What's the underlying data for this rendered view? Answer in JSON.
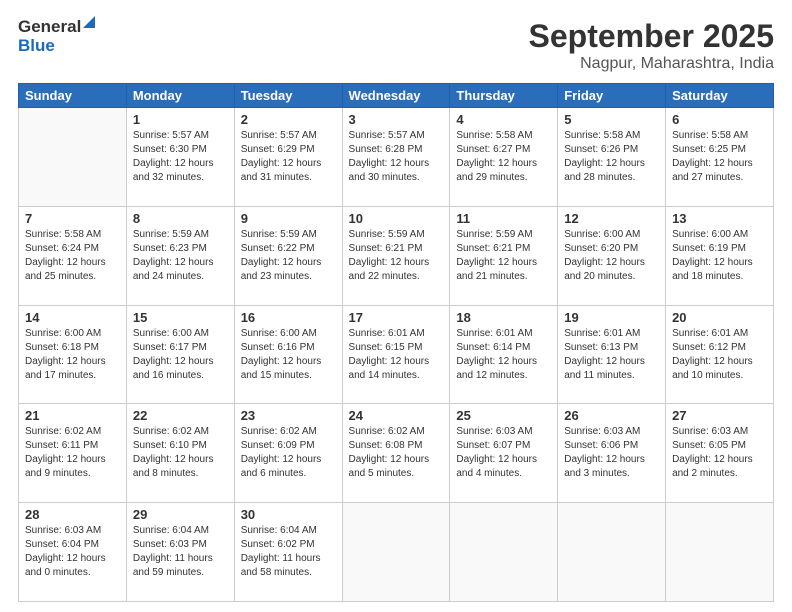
{
  "header": {
    "logo_line1": "General",
    "logo_line2": "Blue",
    "month": "September 2025",
    "location": "Nagpur, Maharashtra, India"
  },
  "weekdays": [
    "Sunday",
    "Monday",
    "Tuesday",
    "Wednesday",
    "Thursday",
    "Friday",
    "Saturday"
  ],
  "weeks": [
    [
      {
        "day": "",
        "info": ""
      },
      {
        "day": "1",
        "info": "Sunrise: 5:57 AM\nSunset: 6:30 PM\nDaylight: 12 hours\nand 32 minutes."
      },
      {
        "day": "2",
        "info": "Sunrise: 5:57 AM\nSunset: 6:29 PM\nDaylight: 12 hours\nand 31 minutes."
      },
      {
        "day": "3",
        "info": "Sunrise: 5:57 AM\nSunset: 6:28 PM\nDaylight: 12 hours\nand 30 minutes."
      },
      {
        "day": "4",
        "info": "Sunrise: 5:58 AM\nSunset: 6:27 PM\nDaylight: 12 hours\nand 29 minutes."
      },
      {
        "day": "5",
        "info": "Sunrise: 5:58 AM\nSunset: 6:26 PM\nDaylight: 12 hours\nand 28 minutes."
      },
      {
        "day": "6",
        "info": "Sunrise: 5:58 AM\nSunset: 6:25 PM\nDaylight: 12 hours\nand 27 minutes."
      }
    ],
    [
      {
        "day": "7",
        "info": "Sunrise: 5:58 AM\nSunset: 6:24 PM\nDaylight: 12 hours\nand 25 minutes."
      },
      {
        "day": "8",
        "info": "Sunrise: 5:59 AM\nSunset: 6:23 PM\nDaylight: 12 hours\nand 24 minutes."
      },
      {
        "day": "9",
        "info": "Sunrise: 5:59 AM\nSunset: 6:22 PM\nDaylight: 12 hours\nand 23 minutes."
      },
      {
        "day": "10",
        "info": "Sunrise: 5:59 AM\nSunset: 6:21 PM\nDaylight: 12 hours\nand 22 minutes."
      },
      {
        "day": "11",
        "info": "Sunrise: 5:59 AM\nSunset: 6:21 PM\nDaylight: 12 hours\nand 21 minutes."
      },
      {
        "day": "12",
        "info": "Sunrise: 6:00 AM\nSunset: 6:20 PM\nDaylight: 12 hours\nand 20 minutes."
      },
      {
        "day": "13",
        "info": "Sunrise: 6:00 AM\nSunset: 6:19 PM\nDaylight: 12 hours\nand 18 minutes."
      }
    ],
    [
      {
        "day": "14",
        "info": "Sunrise: 6:00 AM\nSunset: 6:18 PM\nDaylight: 12 hours\nand 17 minutes."
      },
      {
        "day": "15",
        "info": "Sunrise: 6:00 AM\nSunset: 6:17 PM\nDaylight: 12 hours\nand 16 minutes."
      },
      {
        "day": "16",
        "info": "Sunrise: 6:00 AM\nSunset: 6:16 PM\nDaylight: 12 hours\nand 15 minutes."
      },
      {
        "day": "17",
        "info": "Sunrise: 6:01 AM\nSunset: 6:15 PM\nDaylight: 12 hours\nand 14 minutes."
      },
      {
        "day": "18",
        "info": "Sunrise: 6:01 AM\nSunset: 6:14 PM\nDaylight: 12 hours\nand 12 minutes."
      },
      {
        "day": "19",
        "info": "Sunrise: 6:01 AM\nSunset: 6:13 PM\nDaylight: 12 hours\nand 11 minutes."
      },
      {
        "day": "20",
        "info": "Sunrise: 6:01 AM\nSunset: 6:12 PM\nDaylight: 12 hours\nand 10 minutes."
      }
    ],
    [
      {
        "day": "21",
        "info": "Sunrise: 6:02 AM\nSunset: 6:11 PM\nDaylight: 12 hours\nand 9 minutes."
      },
      {
        "day": "22",
        "info": "Sunrise: 6:02 AM\nSunset: 6:10 PM\nDaylight: 12 hours\nand 8 minutes."
      },
      {
        "day": "23",
        "info": "Sunrise: 6:02 AM\nSunset: 6:09 PM\nDaylight: 12 hours\nand 6 minutes."
      },
      {
        "day": "24",
        "info": "Sunrise: 6:02 AM\nSunset: 6:08 PM\nDaylight: 12 hours\nand 5 minutes."
      },
      {
        "day": "25",
        "info": "Sunrise: 6:03 AM\nSunset: 6:07 PM\nDaylight: 12 hours\nand 4 minutes."
      },
      {
        "day": "26",
        "info": "Sunrise: 6:03 AM\nSunset: 6:06 PM\nDaylight: 12 hours\nand 3 minutes."
      },
      {
        "day": "27",
        "info": "Sunrise: 6:03 AM\nSunset: 6:05 PM\nDaylight: 12 hours\nand 2 minutes."
      }
    ],
    [
      {
        "day": "28",
        "info": "Sunrise: 6:03 AM\nSunset: 6:04 PM\nDaylight: 12 hours\nand 0 minutes."
      },
      {
        "day": "29",
        "info": "Sunrise: 6:04 AM\nSunset: 6:03 PM\nDaylight: 11 hours\nand 59 minutes."
      },
      {
        "day": "30",
        "info": "Sunrise: 6:04 AM\nSunset: 6:02 PM\nDaylight: 11 hours\nand 58 minutes."
      },
      {
        "day": "",
        "info": ""
      },
      {
        "day": "",
        "info": ""
      },
      {
        "day": "",
        "info": ""
      },
      {
        "day": "",
        "info": ""
      }
    ]
  ]
}
